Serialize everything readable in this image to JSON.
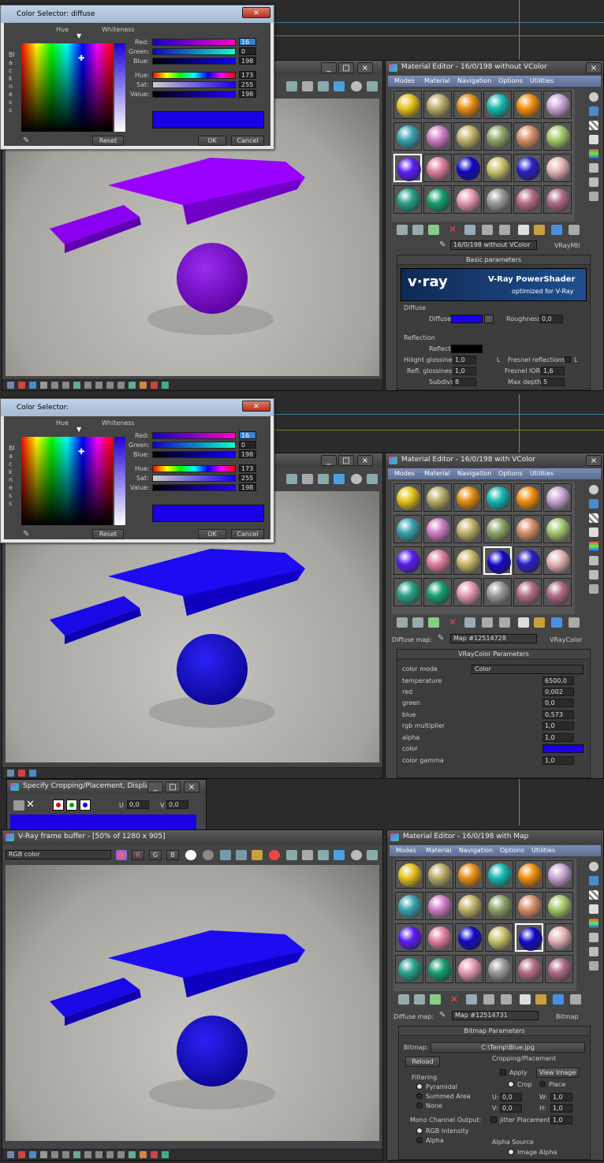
{
  "colors": {
    "accent_blue": "#1a00e6",
    "purple": "#8c00ff",
    "blue_object": "#1d0bf2"
  },
  "panel1": {
    "color_selector": {
      "title": "Color Selector: diffuse",
      "hue_label": "Hue",
      "whiteness_label": "Whiteness",
      "blackness_label": "Blackness",
      "rows": [
        {
          "label": "Red:",
          "value": "16"
        },
        {
          "label": "Green:",
          "value": "0"
        },
        {
          "label": "Blue:",
          "value": "198"
        },
        {
          "label": "Hue:",
          "value": "173"
        },
        {
          "label": "Sat:",
          "value": "255"
        },
        {
          "label": "Value:",
          "value": "198"
        }
      ],
      "reset": "Reset",
      "ok": "OK",
      "cancel": "Cancel"
    },
    "material_editor": {
      "title": "Material Editor - 16/0/198 without VColor",
      "menu": [
        "Modes",
        "Material",
        "Navigation",
        "Options",
        "Utilities"
      ],
      "material_name": "16/0/198 without VColor",
      "material_type": "VRayMtl",
      "rollout_title": "Basic parameters",
      "vray_logo": "v·ray",
      "vray_title": "V-Ray PowerShader",
      "vray_sub": "optimized for V-Ray",
      "diffuse_group": "Diffuse",
      "diffuse_label": "Diffuse",
      "roughness_label": "Roughness",
      "roughness_value": "0,0",
      "reflection_group": "Reflection",
      "reflect_label": "Reflect",
      "hilight_label": "Hilight glossiness",
      "hilight_value": "1,0",
      "l1": "L",
      "fresnel_label": "Fresnel reflections",
      "l2": "L",
      "refl_gloss_label": "Refl. glossiness",
      "refl_gloss_value": "1,0",
      "fresnel_ior_label": "Fresnel IOR",
      "fresnel_ior_value": "1,6",
      "subdivs_label": "Subdivs",
      "subdivs_value": "8",
      "max_depth_label": "Max depth",
      "max_depth_value": "5"
    }
  },
  "panel2": {
    "color_selector": {
      "title": "Color Selector:",
      "hue_label": "Hue",
      "whiteness_label": "Whiteness",
      "blackness_label": "Blackness",
      "rows": [
        {
          "label": "Red:",
          "value": "16"
        },
        {
          "label": "Green:",
          "value": "0"
        },
        {
          "label": "Blue:",
          "value": "198"
        },
        {
          "label": "Hue:",
          "value": "173"
        },
        {
          "label": "Sat:",
          "value": "255"
        },
        {
          "label": "Value:",
          "value": "198"
        }
      ],
      "reset": "Reset",
      "ok": "OK",
      "cancel": "Cancel"
    },
    "material_editor": {
      "title": "Material Editor - 16/0/198 with VColor",
      "menu": [
        "Modes",
        "Material",
        "Navigation",
        "Options",
        "Utilities"
      ],
      "map_label": "Diffuse map:",
      "map_name": "Map #12514728",
      "map_type": "VRayColor",
      "rollout_title": "VRayColor Parameters",
      "params": [
        {
          "label": "color mode",
          "value": "Color"
        },
        {
          "label": "temperature",
          "value": "6500,0"
        },
        {
          "label": "red",
          "value": "0,002"
        },
        {
          "label": "green",
          "value": "0,0"
        },
        {
          "label": "blue",
          "value": "0,573"
        },
        {
          "label": "rgb multiplier",
          "value": "1,0"
        },
        {
          "label": "alpha",
          "value": "1,0"
        },
        {
          "label": "color",
          "value": ""
        },
        {
          "label": "color gamma",
          "value": "1,0"
        }
      ]
    }
  },
  "panel3": {
    "crop_window": {
      "title": "Specify Cropping/Placement, Displa...",
      "u_label": "U",
      "u_value": "0,0",
      "v_label": "V",
      "v_value": "0,0"
    },
    "frame_buffer": {
      "title": "V-Ray frame buffer - [50% of 1280 x 905]",
      "channel": "RGB color",
      "r": "R",
      "g": "G",
      "b": "B"
    },
    "material_editor": {
      "title": "Material Editor - 16/0/198 with Map",
      "menu": [
        "Modes",
        "Material",
        "Navigation",
        "Options",
        "Utilities"
      ],
      "map_label": "Diffuse map:",
      "map_name": "Map #12514731",
      "map_type": "Bitmap",
      "rollout_title": "Bitmap Parameters",
      "bitmap_label": "Bitmap:",
      "bitmap_path": "C:\\Temp\\Blue.jpg",
      "reload": "Reload",
      "cropping_group": "Cropping/Placement",
      "apply": "Apply",
      "view_image": "View Image",
      "crop": "Crop",
      "place": "Place",
      "filtering_group": "Filtering",
      "pyramidal": "Pyramidal",
      "summed_area": "Summed Area",
      "none": "None",
      "u_label": "U:",
      "u_value": "0,0",
      "w_label": "W:",
      "w_value": "1,0",
      "v_label": "V:",
      "v_value": "0,0",
      "h_label": "H:",
      "h_value": "1,0",
      "jitter_label": "Jitter Placement:",
      "jitter_value": "1,0",
      "mono_group": "Mono Channel Output:",
      "rgb_intensity": "RGB Intensity",
      "alpha": "Alpha",
      "alpha_source": "Alpha Source",
      "image_alpha": "Image Alpha"
    }
  }
}
